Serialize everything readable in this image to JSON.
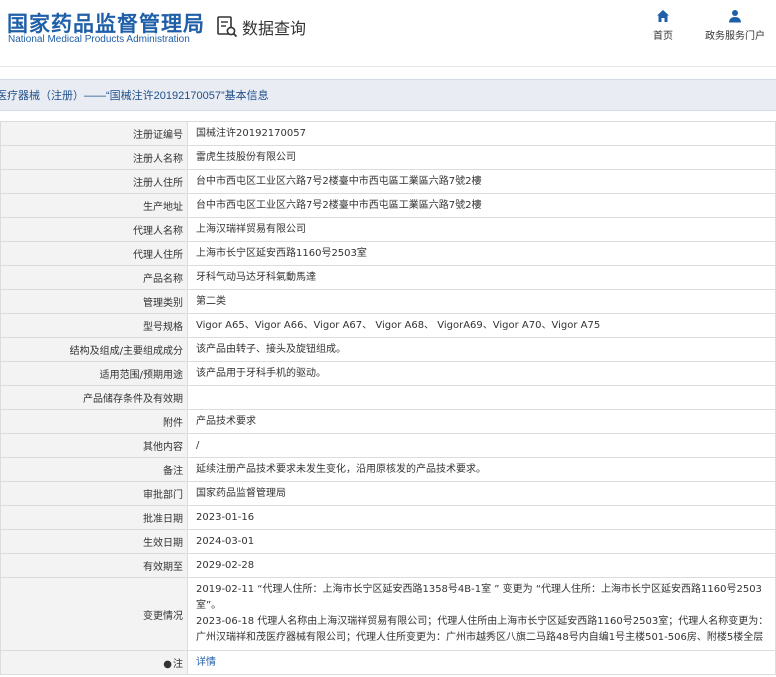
{
  "header": {
    "logo_cn": "国家药品监督管理局",
    "logo_en": "National Medical Products Administration",
    "query_label": "数据查询",
    "nav": [
      {
        "label": "首页",
        "icon": "home-icon"
      },
      {
        "label": "政务服务门户",
        "icon": "user-icon"
      }
    ],
    "accent_color": "#1f5fa8"
  },
  "breadcrumb": "医疗器械（注册）——“国械注许20192170057”基本信息",
  "rows": [
    {
      "label": "注册证编号",
      "value": "国械注许20192170057"
    },
    {
      "label": "注册人名称",
      "value": "雷虎生技股份有限公司"
    },
    {
      "label": "注册人住所",
      "value": "台中市西屯区工业区六路7号2楼臺中市西屯區工業區六路7號2樓"
    },
    {
      "label": "生产地址",
      "value": "台中市西屯区工业区六路7号2楼臺中市西屯區工業區六路7號2樓"
    },
    {
      "label": "代理人名称",
      "value": "上海汉瑞祥贸易有限公司"
    },
    {
      "label": "代理人住所",
      "value": "上海市长宁区延安西路1160号2503室"
    },
    {
      "label": "产品名称",
      "value": "牙科气动马达牙科氣動馬達"
    },
    {
      "label": "管理类别",
      "value": "第二类"
    },
    {
      "label": "型号规格",
      "value": "Vigor A65、Vigor A66、Vigor A67、 Vigor A68、 VigorA69、Vigor A70、Vigor A75"
    },
    {
      "label": "结构及组成/主要组成成分",
      "value": "该产品由转子、接头及旋钮组成。"
    },
    {
      "label": "适用范围/预期用途",
      "value": "该产品用于牙科手机的驱动。"
    },
    {
      "label": "产品储存条件及有效期",
      "value": ""
    },
    {
      "label": "附件",
      "value": "产品技术要求"
    },
    {
      "label": "其他内容",
      "value": "/"
    },
    {
      "label": "备注",
      "value": "延续注册产品技术要求未发生变化，沿用原核发的产品技术要求。"
    },
    {
      "label": "审批部门",
      "value": "国家药品监督管理局"
    },
    {
      "label": "批准日期",
      "value": "2023-01-16"
    },
    {
      "label": "生效日期",
      "value": "2024-03-01"
    },
    {
      "label": "有效期至",
      "value": "2029-02-28"
    }
  ],
  "change": {
    "label": "变更情况",
    "lines": [
      "2019-02-11 “代理人住所：上海市长宁区延安西路1358号4B-1室 ” 变更为 “代理人住所：上海市长宁区延安西路1160号2503室”。",
      "2023-06-18 代理人名称由上海汉瑞祥贸易有限公司；代理人住所由上海市长宁区延安西路1160号2503室；代理人名称变更为：广州汉瑞祥和茂医疗器械有限公司；代理人住所变更为：广州市越秀区八旗二马路48号内自编1号主楼501-506房、附楼5楼全层"
    ]
  },
  "note": {
    "icon": "●",
    "label": "注",
    "link": "详情"
  }
}
